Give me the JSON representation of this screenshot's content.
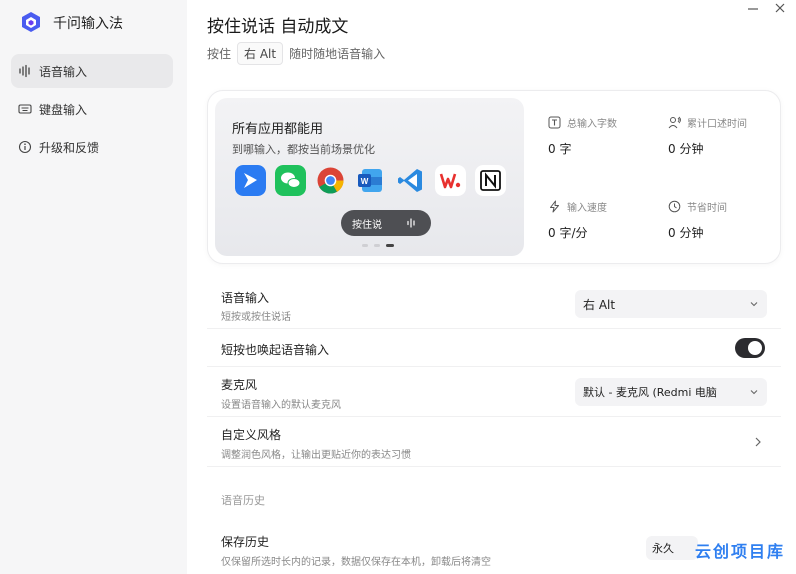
{
  "app": {
    "name": "千问输入法"
  },
  "sidebar": {
    "items": [
      {
        "label": "语音输入",
        "active": true,
        "icon": "voice-wave-icon"
      },
      {
        "label": "键盘输入",
        "active": false,
        "icon": "keyboard-icon"
      },
      {
        "label": "升级和反馈",
        "active": false,
        "icon": "info-icon"
      }
    ]
  },
  "header": {
    "title": "按住说话 自动成文",
    "subtitle_pre": "按住",
    "hotkey": "右 Alt",
    "subtitle_post": "随时随地语音输入"
  },
  "hero": {
    "heading": "所有应用都能用",
    "sub": "到哪输入，都按当前场景优化",
    "apps": [
      "feishu-icon",
      "wechat-icon",
      "chrome-icon",
      "word-icon",
      "vscode-icon",
      "wps-icon",
      "notion-icon"
    ],
    "ptt_label": "按住说",
    "carousel_index": 2
  },
  "stats": [
    {
      "label": "总输入字数",
      "value": "0 字",
      "icon": "text-icon"
    },
    {
      "label": "累计口述时间",
      "value": "0 分钟",
      "icon": "speaker-icon"
    },
    {
      "label": "输入速度",
      "value": "0 字/分",
      "icon": "lightning-icon"
    },
    {
      "label": "节省时间",
      "value": "0 分钟",
      "icon": "clock-icon"
    }
  ],
  "settings": {
    "voice_input": {
      "title": "语音输入",
      "desc": "短按或按住说话",
      "value": "右 Alt"
    },
    "short_press": {
      "title": "短按也唤起语音输入",
      "enabled": true
    },
    "microphone": {
      "title": "麦克风",
      "desc": "设置语音输入的默认麦克风",
      "value": "默认 - 麦克风 (Redmi 电脑"
    },
    "style": {
      "title": "自定义风格",
      "desc": "调整润色风格，让输出更贴近你的表达习惯"
    },
    "history_section": "语音历史",
    "save_history": {
      "title": "保存历史",
      "desc": "仅保留所选时长内的记录，数据仅保存在本机，卸载后将清空",
      "value": "永久"
    }
  },
  "watermark": "云创项目库",
  "colors": {
    "accent": "#2b2b2f",
    "watermark": "#2f7ff0"
  }
}
